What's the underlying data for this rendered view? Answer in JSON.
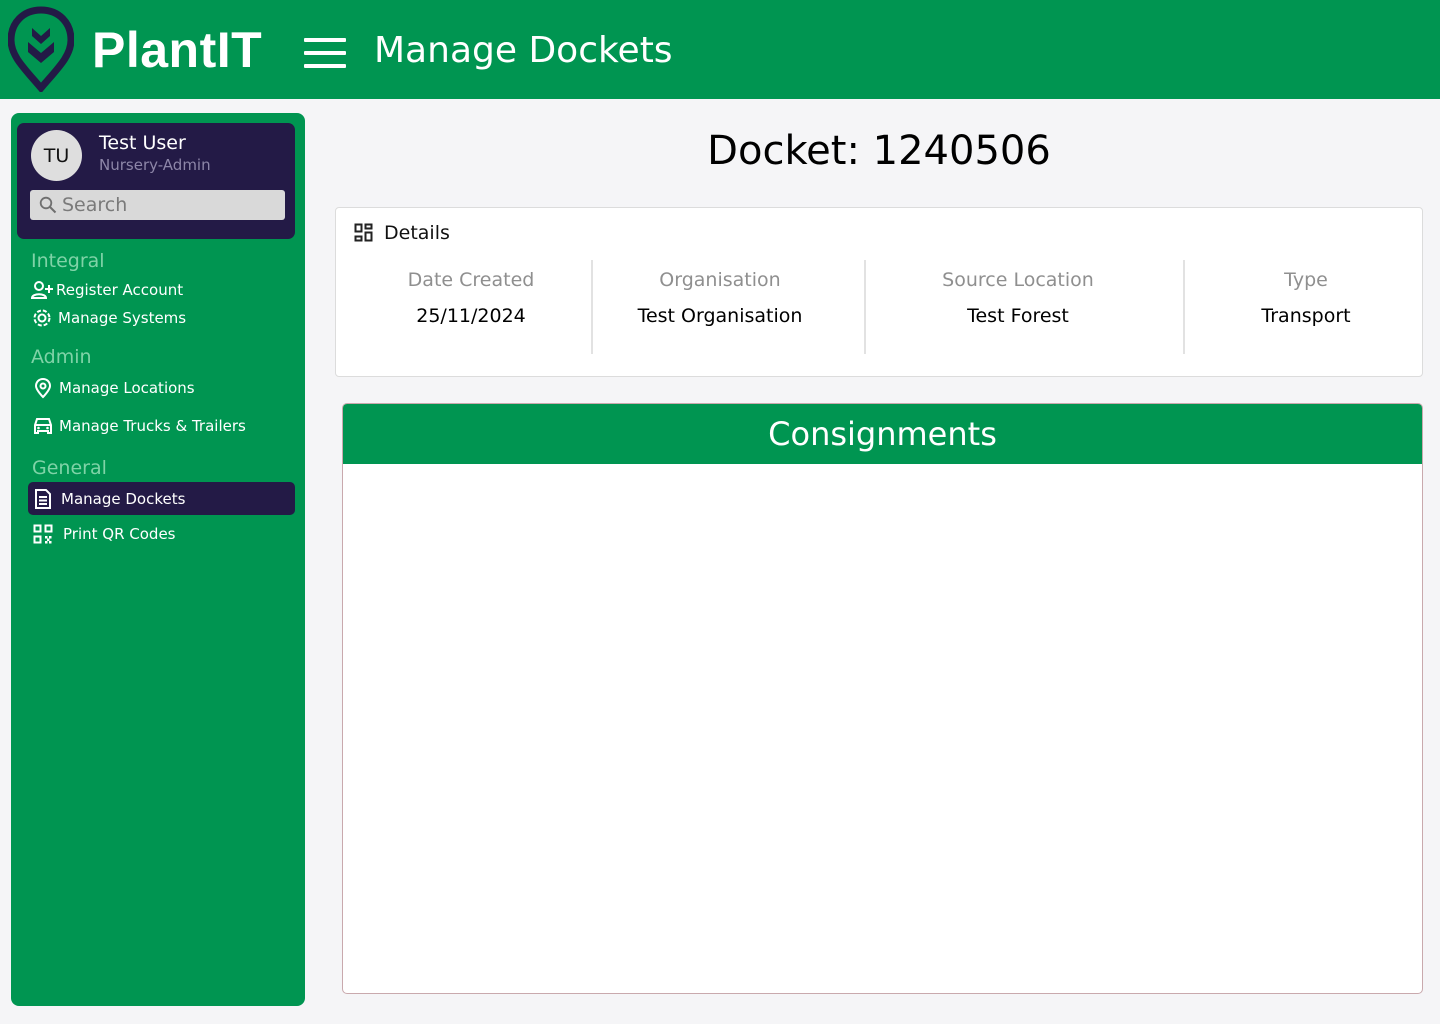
{
  "header": {
    "brand": "PlantIT",
    "page_title": "Manage Dockets",
    "brand_color": "#009551",
    "accent_dark": "#231a46"
  },
  "sidebar": {
    "user": {
      "initials": "TU",
      "name": "Test User",
      "role": "Nursery-Admin"
    },
    "search": {
      "placeholder": "Search",
      "value": ""
    },
    "sections": [
      {
        "label": "Integral",
        "items": [
          {
            "label": "Register Account",
            "icon": "user-plus-icon"
          },
          {
            "label": "Manage Systems",
            "icon": "gear-icon"
          }
        ]
      },
      {
        "label": "Admin",
        "items": [
          {
            "label": "Manage Locations",
            "icon": "map-pin-icon"
          },
          {
            "label": "Manage Trucks & Trailers",
            "icon": "car-icon"
          }
        ]
      },
      {
        "label": "General",
        "items": [
          {
            "label": "Manage Dockets",
            "icon": "document-icon",
            "active": true
          },
          {
            "label": "Print QR Codes",
            "icon": "qr-code-icon"
          }
        ]
      }
    ]
  },
  "main": {
    "docket_title": "Docket: 1240506",
    "details": {
      "heading": "Details",
      "fields": [
        {
          "label": "Date Created",
          "value": "25/11/2024"
        },
        {
          "label": "Organisation",
          "value": "Test Organisation"
        },
        {
          "label": "Source Location",
          "value": "Test Forest"
        },
        {
          "label": "Type",
          "value": "Transport"
        }
      ]
    },
    "consignments": {
      "heading": "Consignments",
      "rows": []
    }
  }
}
